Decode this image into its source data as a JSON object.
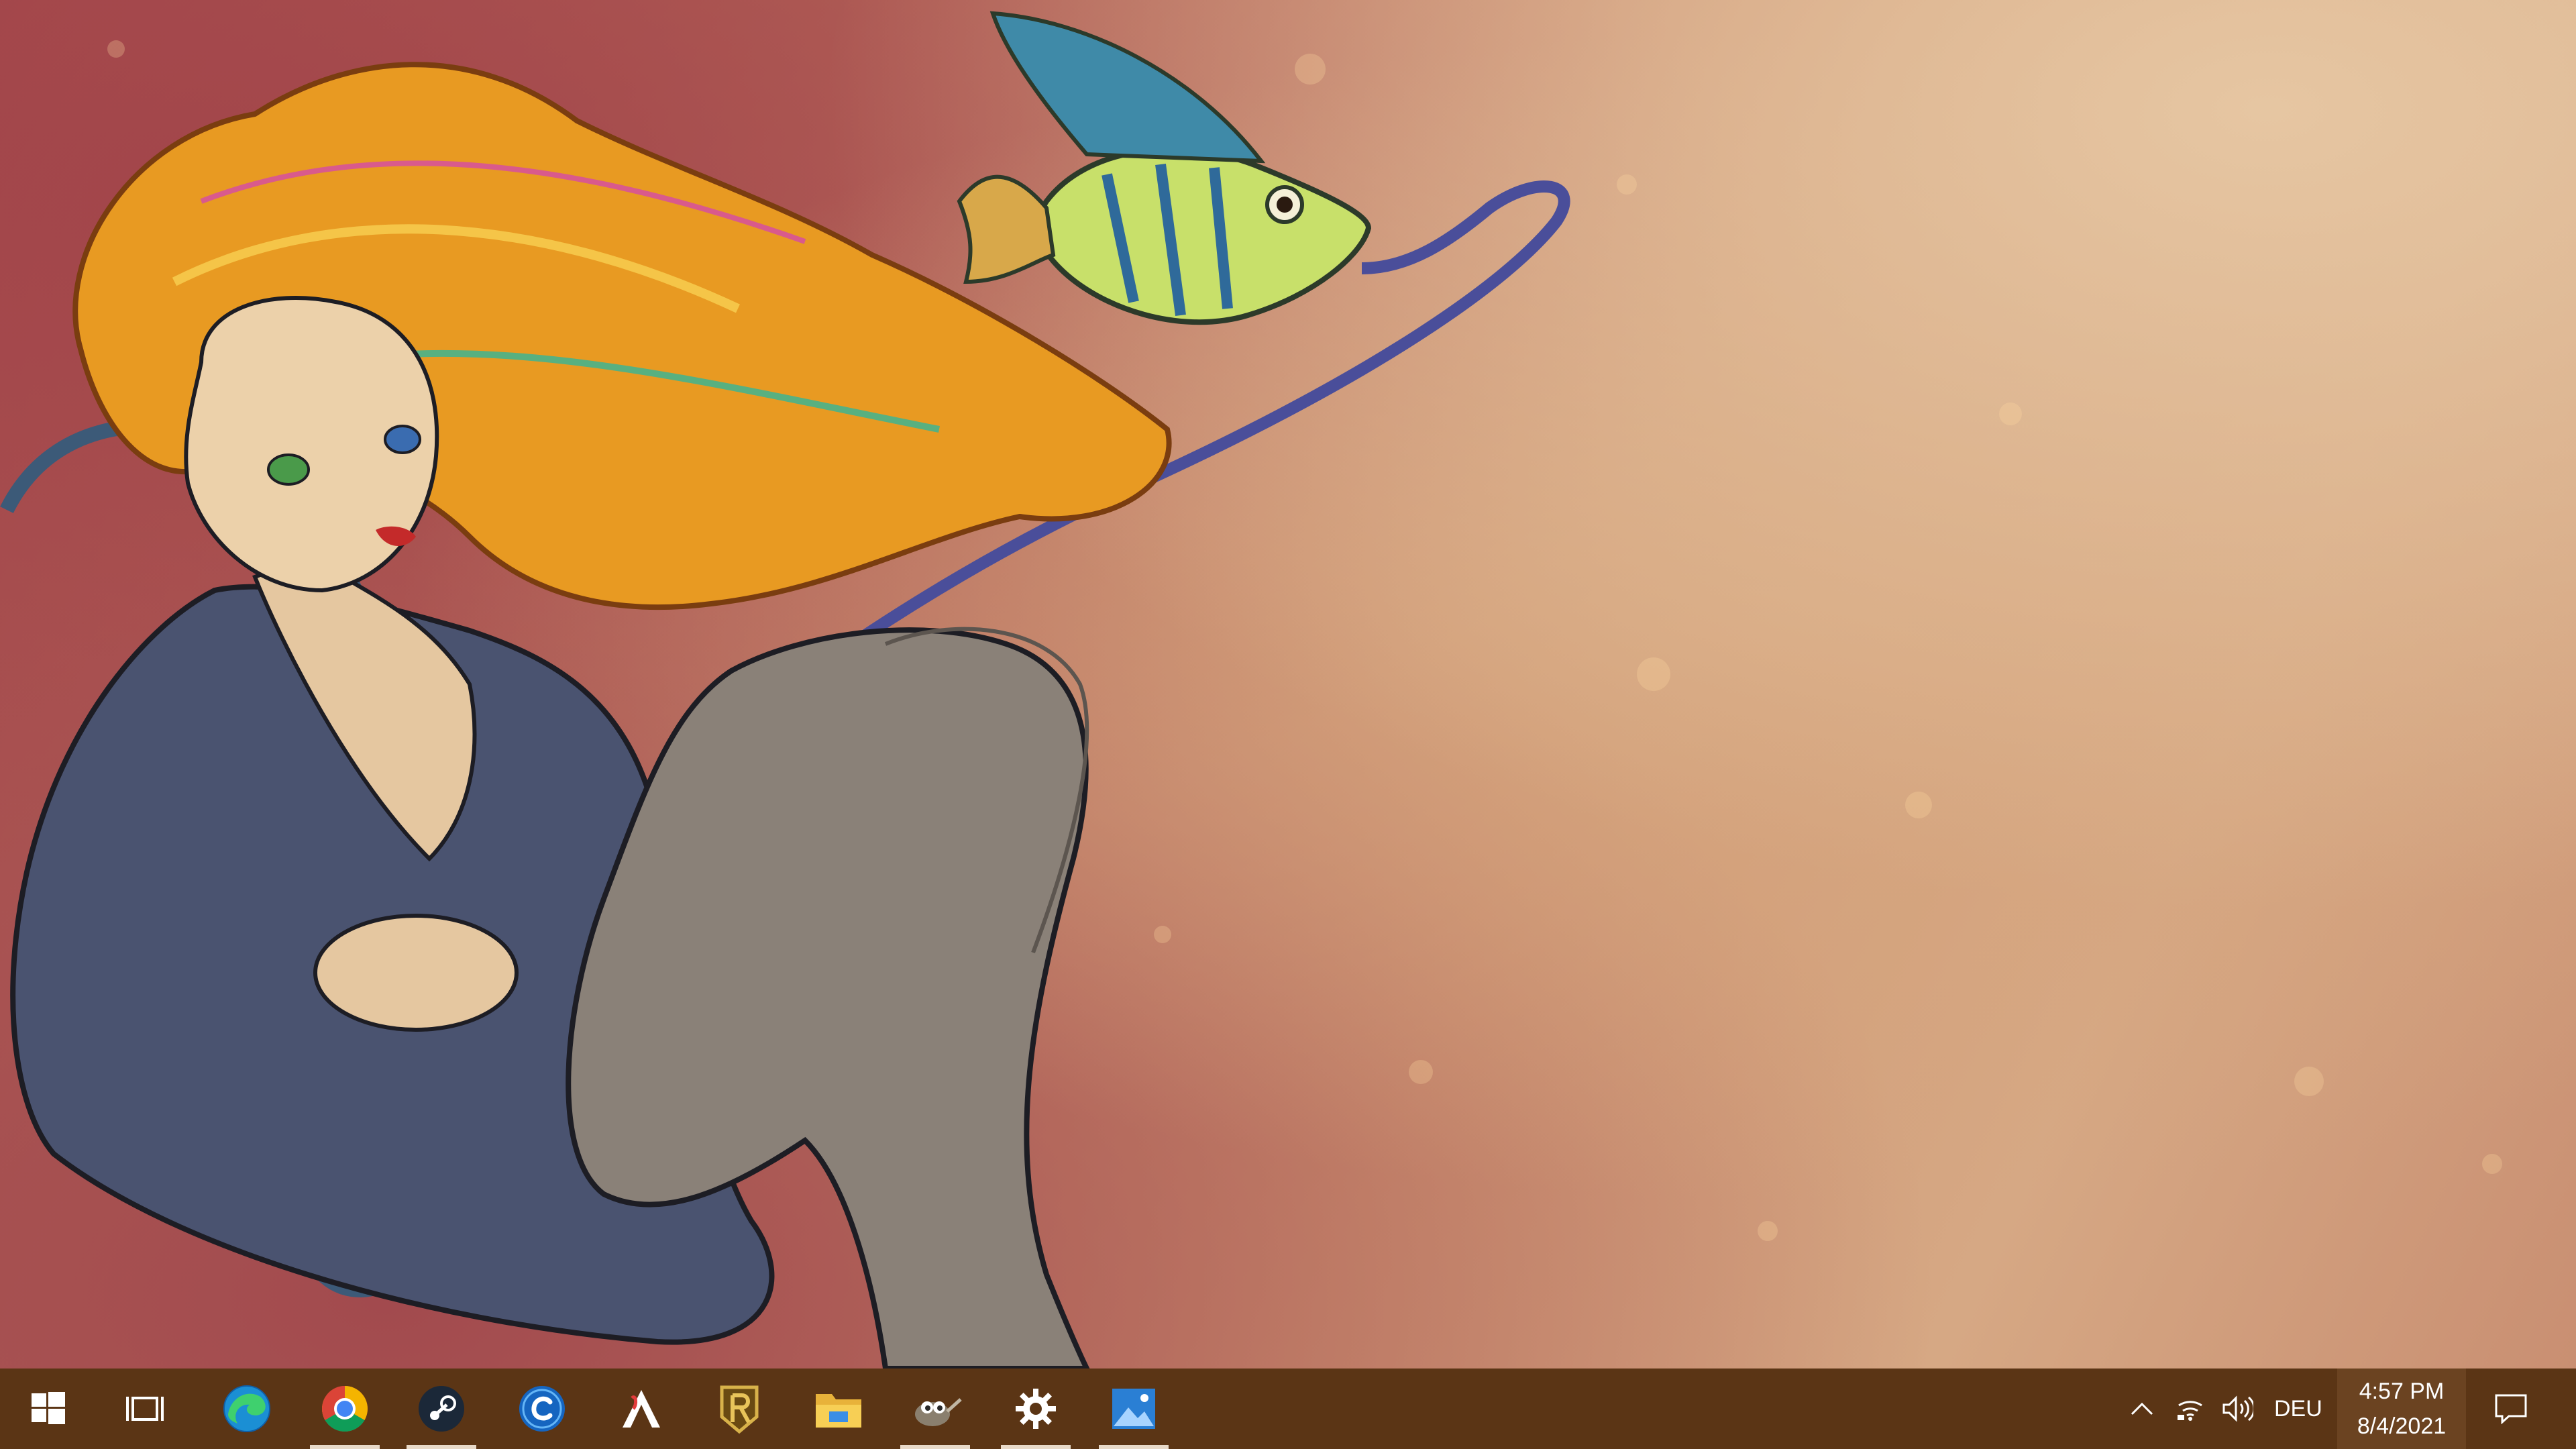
{
  "desktop": {
    "wallpaper": "illustrated-girl-with-fish-wallpaper"
  },
  "taskbar": {
    "background_color": "#5b3515",
    "apps": [
      {
        "name": "start",
        "icon": "windows-logo-icon",
        "running": false
      },
      {
        "name": "task-view",
        "icon": "task-view-icon",
        "running": false
      },
      {
        "name": "edge",
        "icon": "edge-icon",
        "running": false
      },
      {
        "name": "chrome",
        "icon": "chrome-icon",
        "running": true
      },
      {
        "name": "steam",
        "icon": "steam-icon",
        "running": true
      },
      {
        "name": "ccleaner",
        "icon": "ccleaner-icon",
        "running": false
      },
      {
        "name": "adobe-acrobat",
        "icon": "acrobat-icon",
        "running": false
      },
      {
        "name": "legends-of-runeterra",
        "icon": "runeterra-icon",
        "running": false
      },
      {
        "name": "file-explorer",
        "icon": "folder-icon",
        "running": false
      },
      {
        "name": "gimp",
        "icon": "gimp-icon",
        "running": true
      },
      {
        "name": "settings",
        "icon": "gear-icon",
        "running": true
      },
      {
        "name": "photos",
        "icon": "photos-icon",
        "running": true
      }
    ],
    "tray": {
      "icons": [
        "chevron-up-icon",
        "wifi-icon",
        "volume-icon"
      ],
      "language": "DEU",
      "time": "4:57 PM",
      "date": "8/4/2021",
      "notification_icon": "notification-icon"
    }
  }
}
